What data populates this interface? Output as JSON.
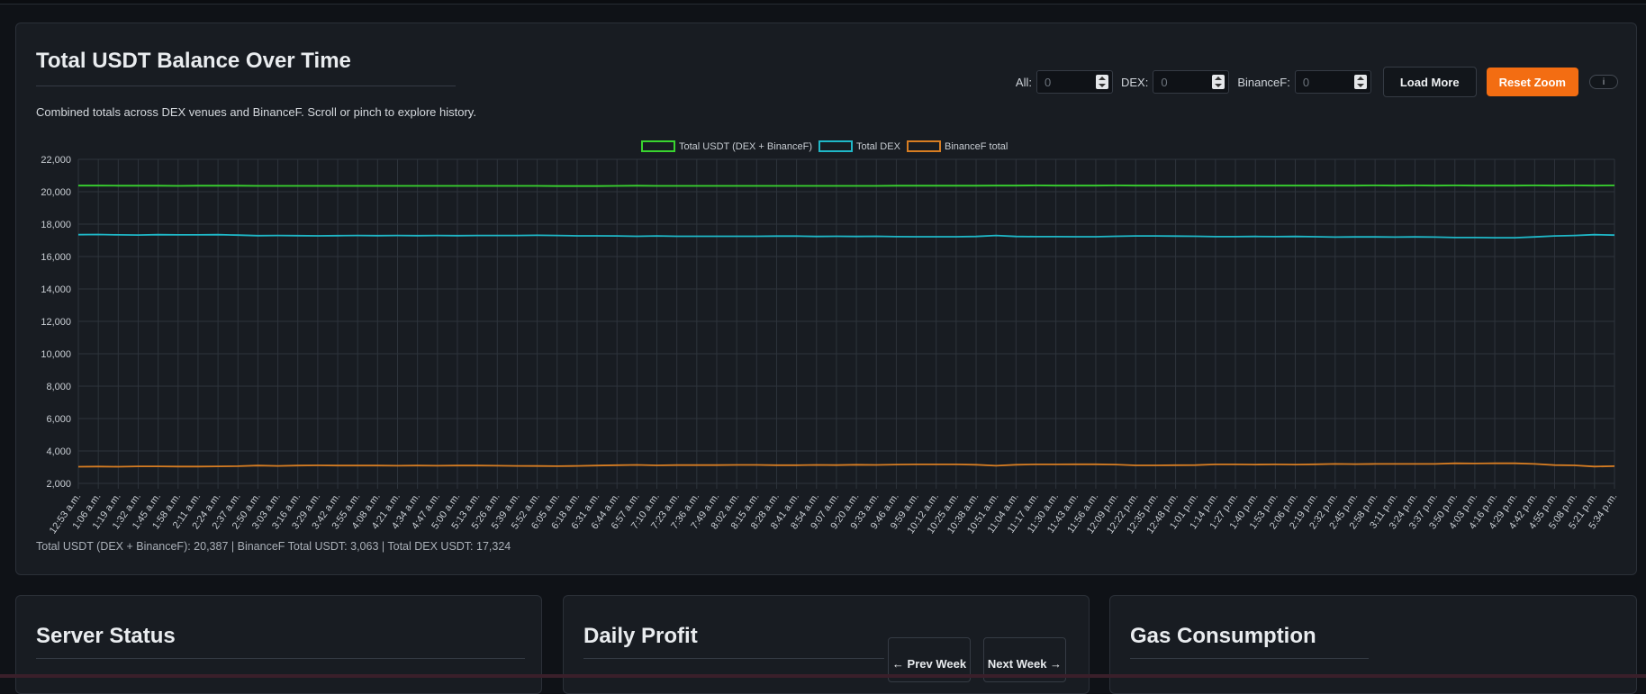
{
  "balance_panel": {
    "title": "Total USDT Balance Over Time",
    "subtitle": "Combined totals across DEX venues and BinanceF. Scroll or pinch to explore history.",
    "controls": {
      "all_label": "All:",
      "all_value": "0",
      "dex_label": "DEX:",
      "dex_value": "0",
      "binance_label": "BinanceF:",
      "binance_value": "0",
      "load_more": "Load More",
      "reset_zoom": "Reset Zoom",
      "info": "i"
    },
    "summary": "Total USDT (DEX + BinanceF): 20,387 | BinanceF Total USDT: 3,063 | Total DEX USDT: 17,324"
  },
  "colors": {
    "total": "#39d42f",
    "dex": "#1fb8c8",
    "binance": "#d77d22",
    "accent": "#f36d12"
  },
  "chart_data": {
    "type": "line",
    "title": "",
    "xlabel": "",
    "ylabel": "",
    "ylim": [
      2000,
      22000
    ],
    "yticks": [
      "22,000",
      "20,000",
      "18,000",
      "16,000",
      "14,000",
      "12,000",
      "10,000",
      "8,000",
      "6,000",
      "4,000",
      "2,000"
    ],
    "grid": true,
    "legend_position": "top-center",
    "x": [
      "12:53 a.m.",
      "1:06 a.m.",
      "1:19 a.m.",
      "1:32 a.m.",
      "1:45 a.m.",
      "1:58 a.m.",
      "2:11 a.m.",
      "2:24 a.m.",
      "2:37 a.m.",
      "2:50 a.m.",
      "3:03 a.m.",
      "3:16 a.m.",
      "3:29 a.m.",
      "3:42 a.m.",
      "3:55 a.m.",
      "4:08 a.m.",
      "4:21 a.m.",
      "4:34 a.m.",
      "4:47 a.m.",
      "5:00 a.m.",
      "5:13 a.m.",
      "5:26 a.m.",
      "5:39 a.m.",
      "5:52 a.m.",
      "6:05 a.m.",
      "6:18 a.m.",
      "6:31 a.m.",
      "6:44 a.m.",
      "6:57 a.m.",
      "7:10 a.m.",
      "7:23 a.m.",
      "7:36 a.m.",
      "7:49 a.m.",
      "8:02 a.m.",
      "8:15 a.m.",
      "8:28 a.m.",
      "8:41 a.m.",
      "8:54 a.m.",
      "9:07 a.m.",
      "9:20 a.m.",
      "9:33 a.m.",
      "9:46 a.m.",
      "9:59 a.m.",
      "10:12 a.m.",
      "10:25 a.m.",
      "10:38 a.m.",
      "10:51 a.m.",
      "11:04 a.m.",
      "11:17 a.m.",
      "11:30 a.m.",
      "11:43 a.m.",
      "11:56 a.m.",
      "12:09 p.m.",
      "12:22 p.m.",
      "12:35 p.m.",
      "12:48 p.m.",
      "1:01 p.m.",
      "1:14 p.m.",
      "1:27 p.m.",
      "1:40 p.m.",
      "1:53 p.m.",
      "2:06 p.m.",
      "2:19 p.m.",
      "2:32 p.m.",
      "2:45 p.m.",
      "2:58 p.m.",
      "3:11 p.m.",
      "3:24 p.m.",
      "3:37 p.m.",
      "3:50 p.m.",
      "4:03 p.m.",
      "4:16 p.m.",
      "4:29 p.m.",
      "4:42 p.m.",
      "4:55 p.m.",
      "5:08 p.m.",
      "5:21 p.m.",
      "5:34 p.m."
    ],
    "series": [
      {
        "name": "Total USDT (DEX + BinanceF)",
        "values": [
          20380,
          20380,
          20370,
          20370,
          20370,
          20360,
          20370,
          20370,
          20370,
          20360,
          20360,
          20360,
          20360,
          20360,
          20360,
          20360,
          20360,
          20360,
          20360,
          20360,
          20360,
          20360,
          20360,
          20360,
          20350,
          20350,
          20350,
          20360,
          20370,
          20360,
          20360,
          20360,
          20360,
          20360,
          20360,
          20360,
          20360,
          20360,
          20360,
          20360,
          20360,
          20370,
          20370,
          20370,
          20370,
          20370,
          20380,
          20380,
          20390,
          20380,
          20380,
          20380,
          20390,
          20380,
          20380,
          20380,
          20380,
          20380,
          20380,
          20380,
          20380,
          20380,
          20380,
          20380,
          20380,
          20390,
          20380,
          20390,
          20380,
          20390,
          20380,
          20380,
          20380,
          20390,
          20380,
          20390,
          20380,
          20387
        ]
      },
      {
        "name": "Total DEX",
        "values": [
          17350,
          17360,
          17340,
          17330,
          17350,
          17340,
          17340,
          17350,
          17320,
          17290,
          17300,
          17290,
          17280,
          17290,
          17300,
          17290,
          17300,
          17290,
          17300,
          17290,
          17300,
          17300,
          17300,
          17310,
          17300,
          17280,
          17280,
          17270,
          17250,
          17270,
          17250,
          17250,
          17250,
          17250,
          17250,
          17260,
          17260,
          17240,
          17250,
          17240,
          17250,
          17230,
          17220,
          17220,
          17220,
          17240,
          17300,
          17240,
          17230,
          17230,
          17220,
          17220,
          17250,
          17270,
          17270,
          17260,
          17250,
          17230,
          17230,
          17240,
          17230,
          17240,
          17220,
          17200,
          17210,
          17210,
          17200,
          17210,
          17200,
          17170,
          17170,
          17160,
          17160,
          17210,
          17270,
          17300,
          17350,
          17324
        ]
      },
      {
        "name": "BinanceF total",
        "values": [
          3030,
          3040,
          3030,
          3050,
          3050,
          3040,
          3040,
          3050,
          3060,
          3100,
          3080,
          3100,
          3110,
          3100,
          3100,
          3100,
          3090,
          3100,
          3090,
          3100,
          3100,
          3090,
          3080,
          3070,
          3060,
          3080,
          3100,
          3120,
          3140,
          3110,
          3130,
          3130,
          3130,
          3140,
          3140,
          3120,
          3120,
          3140,
          3130,
          3150,
          3140,
          3160,
          3170,
          3170,
          3170,
          3150,
          3090,
          3150,
          3170,
          3170,
          3180,
          3180,
          3160,
          3110,
          3110,
          3120,
          3130,
          3170,
          3170,
          3160,
          3170,
          3160,
          3180,
          3200,
          3190,
          3200,
          3200,
          3200,
          3200,
          3240,
          3230,
          3240,
          3240,
          3200,
          3130,
          3110,
          3040,
          3063
        ]
      }
    ]
  },
  "server_panel": {
    "title": "Server Status"
  },
  "profit_panel": {
    "title": "Daily Profit",
    "prev_week": "← Prev Week",
    "next_week": "Next Week →"
  },
  "gas_panel": {
    "title": "Gas Consumption"
  }
}
